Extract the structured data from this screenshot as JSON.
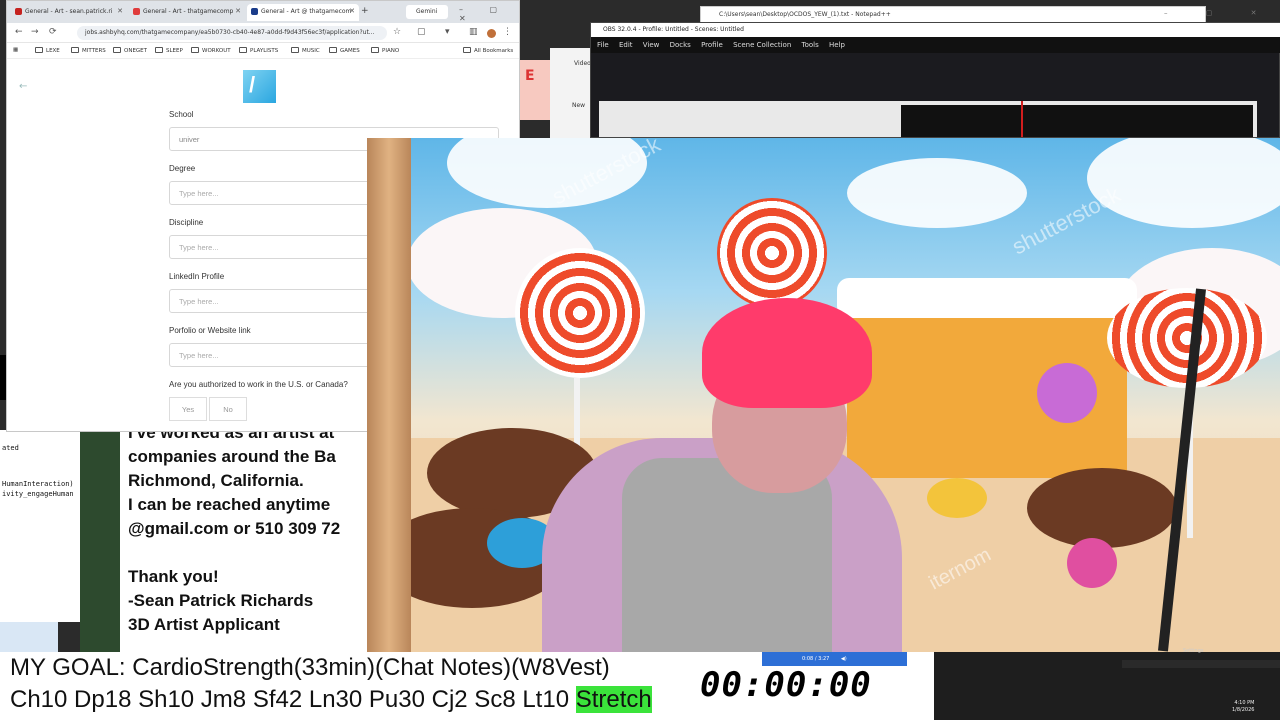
{
  "browser": {
    "tabs": [
      {
        "label": "General - Art - sean.patrick.ri",
        "icon_color": "#c5221f"
      },
      {
        "label": "General - Art - thatgamecomp",
        "icon_color": "#e03c3c"
      },
      {
        "label": "General - Art @ thatgamecom",
        "icon_color": "#1a3c8a"
      }
    ],
    "gemini_tab": "Gemini",
    "new_tab": "+",
    "window_controls": "– ▢ ✕",
    "url": "jobs.ashbyhq.com/thatgamecompany/ea5b0730-cb40-4e87-a0dd-f9d43f56ec3f/application?ut...",
    "nav": {
      "back": "←",
      "forward": "→",
      "reload": "⟳"
    },
    "bookmarks": [
      "LEXE",
      "MITTERS",
      "ONEGET",
      "SLEEP",
      "WORKOUT",
      "PLAYLISTS",
      "MUSIC",
      "GAMES",
      "PIANO"
    ],
    "bookmarks_all": "All Bookmarks"
  },
  "form": {
    "back_arrow": "←",
    "logo_glyph": "/",
    "fields": [
      {
        "label": "School",
        "value": "univer",
        "placeholder": ""
      },
      {
        "label": "Degree",
        "value": "",
        "placeholder": "Type here..."
      },
      {
        "label": "Discipline",
        "value": "",
        "placeholder": "Type here..."
      },
      {
        "label": "LinkedIn Profile",
        "value": "",
        "placeholder": "Type here..."
      },
      {
        "label": "Porfolio or Website link",
        "value": "",
        "placeholder": "Type here..."
      }
    ],
    "work_auth_question": "Are you authorized to work in the U.S. or Canada?",
    "yes": "Yes",
    "no": "No"
  },
  "email": {
    "lines": [
      "I've worked as an artist at",
      "companies around the Ba",
      "Richmond, California.",
      "I can be reached anytime",
      "@gmail.com or 510 309 72",
      "",
      "Thank you!",
      "-Sean Patrick Richards",
      "3D Artist Applicant"
    ]
  },
  "under_left": {
    "lines": [
      "ated",
      "",
      "",
      "HumanInteraction)",
      "ivity_engageHuman"
    ]
  },
  "under_mid": {
    "label_videos": "Videos",
    "label_new": "New",
    "red_letter": "E"
  },
  "notepad": {
    "title": "C:\\Users\\sean\\Desktop\\OCDOS_YEW_(1).txt - Notepad++"
  },
  "obs": {
    "title": "OBS 32.0.4 - Profile: Untitled - Scenes: Untitled",
    "menu": [
      "File",
      "Edit",
      "View",
      "Docks",
      "Profile",
      "Scene Collection",
      "Tools",
      "Help"
    ]
  },
  "cam": {
    "watermark": "shutterstock",
    "watermark_alt": "iternom"
  },
  "ticker": {
    "goal": "MY GOAL: CardioStrength(33min)(Chat Notes)(W8Vest)",
    "stats": "Ch10 Dp18 Sh10 Jm8 Sf42 Ln30 Pu30 Cj2 Sc8 Lt10",
    "stretch": "Stretch",
    "timer": "00:00:00"
  },
  "media": {
    "position": "0:08 / 3:27"
  },
  "taskbar": {
    "settings": "Settings",
    "time": "4:10 PM",
    "date": "1/8/2026"
  }
}
